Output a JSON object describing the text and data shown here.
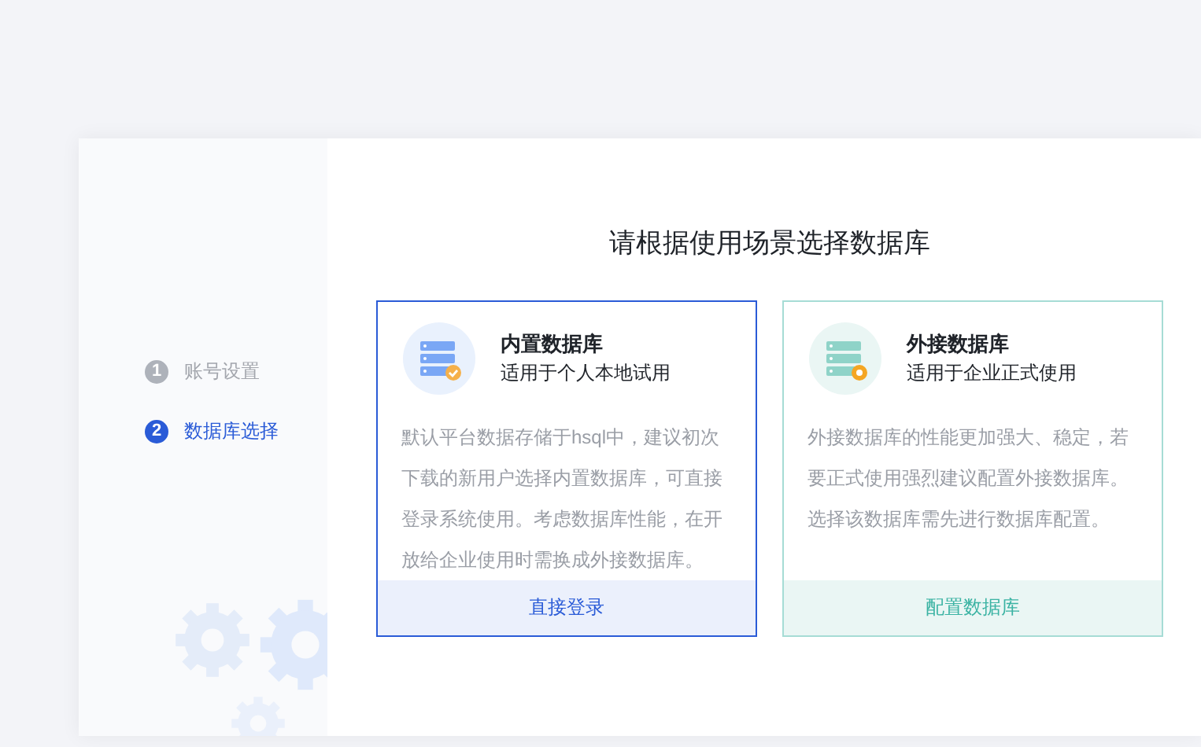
{
  "steps": [
    {
      "number": "1",
      "label": "账号设置",
      "selected": false
    },
    {
      "number": "2",
      "label": "数据库选择",
      "selected": true
    }
  ],
  "title": "请根据使用场景选择数据库",
  "cards": [
    {
      "kind": "builtin",
      "name": "内置数据库",
      "subtitle": "适用于个人本地试用",
      "description": "默认平台数据存储于hsql中，建议初次下载的新用户选择内置数据库，可直接登录系统使用。考虑数据库性能，在开放给企业使用时需换成外接数据库。",
      "action": "直接登录",
      "selected": true
    },
    {
      "kind": "external",
      "name": "外接数据库",
      "subtitle": "适用于企业正式使用",
      "description": "外接数据库的性能更加强大、稳定，若要正式使用强烈建议配置外接数据库。选择该数据库需先进行数据库配置。",
      "action": "配置数据库",
      "selected": false
    }
  ]
}
